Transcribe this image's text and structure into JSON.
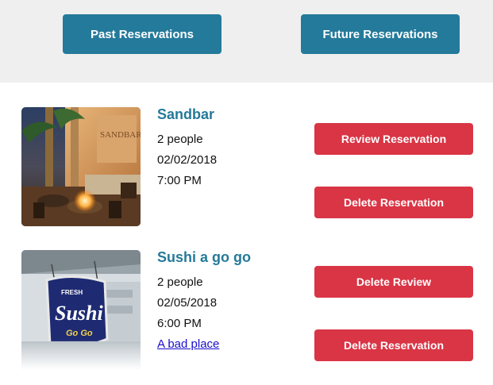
{
  "nav": {
    "past_label": "Past Reservations",
    "future_label": "Future Reservations"
  },
  "reservations": [
    {
      "name": "Sandbar",
      "party": "2 people",
      "date": "02/02/2018",
      "time": "7:00 PM",
      "primary_action": "Review Reservation",
      "secondary_action": "Delete Reservation",
      "image_desc": "restaurant-patio-photo",
      "image_text": "SANDBAR"
    },
    {
      "name": "Sushi a go go",
      "party": "2 people",
      "date": "02/05/2018",
      "time": "6:00 PM",
      "review_link": "A bad place",
      "primary_action": "Delete Review",
      "secondary_action": "Delete Reservation",
      "image_desc": "sushi-sign-photo",
      "image_text": "FRESH Sushi Go Go"
    }
  ],
  "colors": {
    "accent": "#247a9a",
    "danger": "#d93545",
    "topbar_bg": "#efefef",
    "link": "#1a0dcc"
  }
}
